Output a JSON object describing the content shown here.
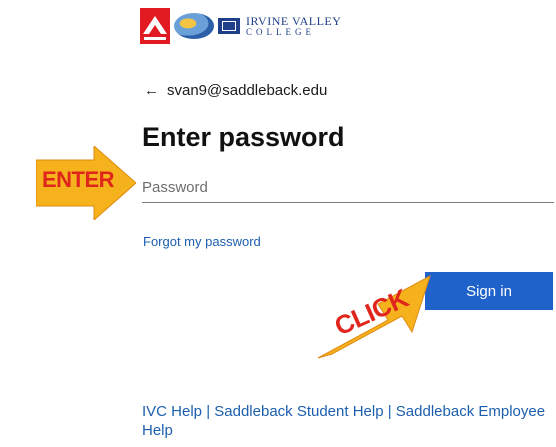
{
  "logos": {
    "saddleback": "",
    "ivc_line1": "IRVINE VALLEY",
    "ivc_line2": "COLLEGE"
  },
  "identity": {
    "back_icon": "←",
    "email": "svan9@saddleback.edu"
  },
  "title": "Enter password",
  "password": {
    "placeholder": "Password",
    "value": ""
  },
  "forgot_label": "Forgot my password",
  "signin_label": "Sign in",
  "annotations": {
    "enter_label": "ENTER",
    "click_label": "CLICK"
  },
  "footer": {
    "link1": "IVC Help",
    "sep": " | ",
    "link2": "Saddleback Student Help",
    "link3": "Saddleback Employee Help"
  },
  "colors": {
    "accent": "#1f62c9",
    "link": "#1d5fae",
    "annotation_red": "#e0261c",
    "annotation_yellow": "#f5b21c"
  }
}
